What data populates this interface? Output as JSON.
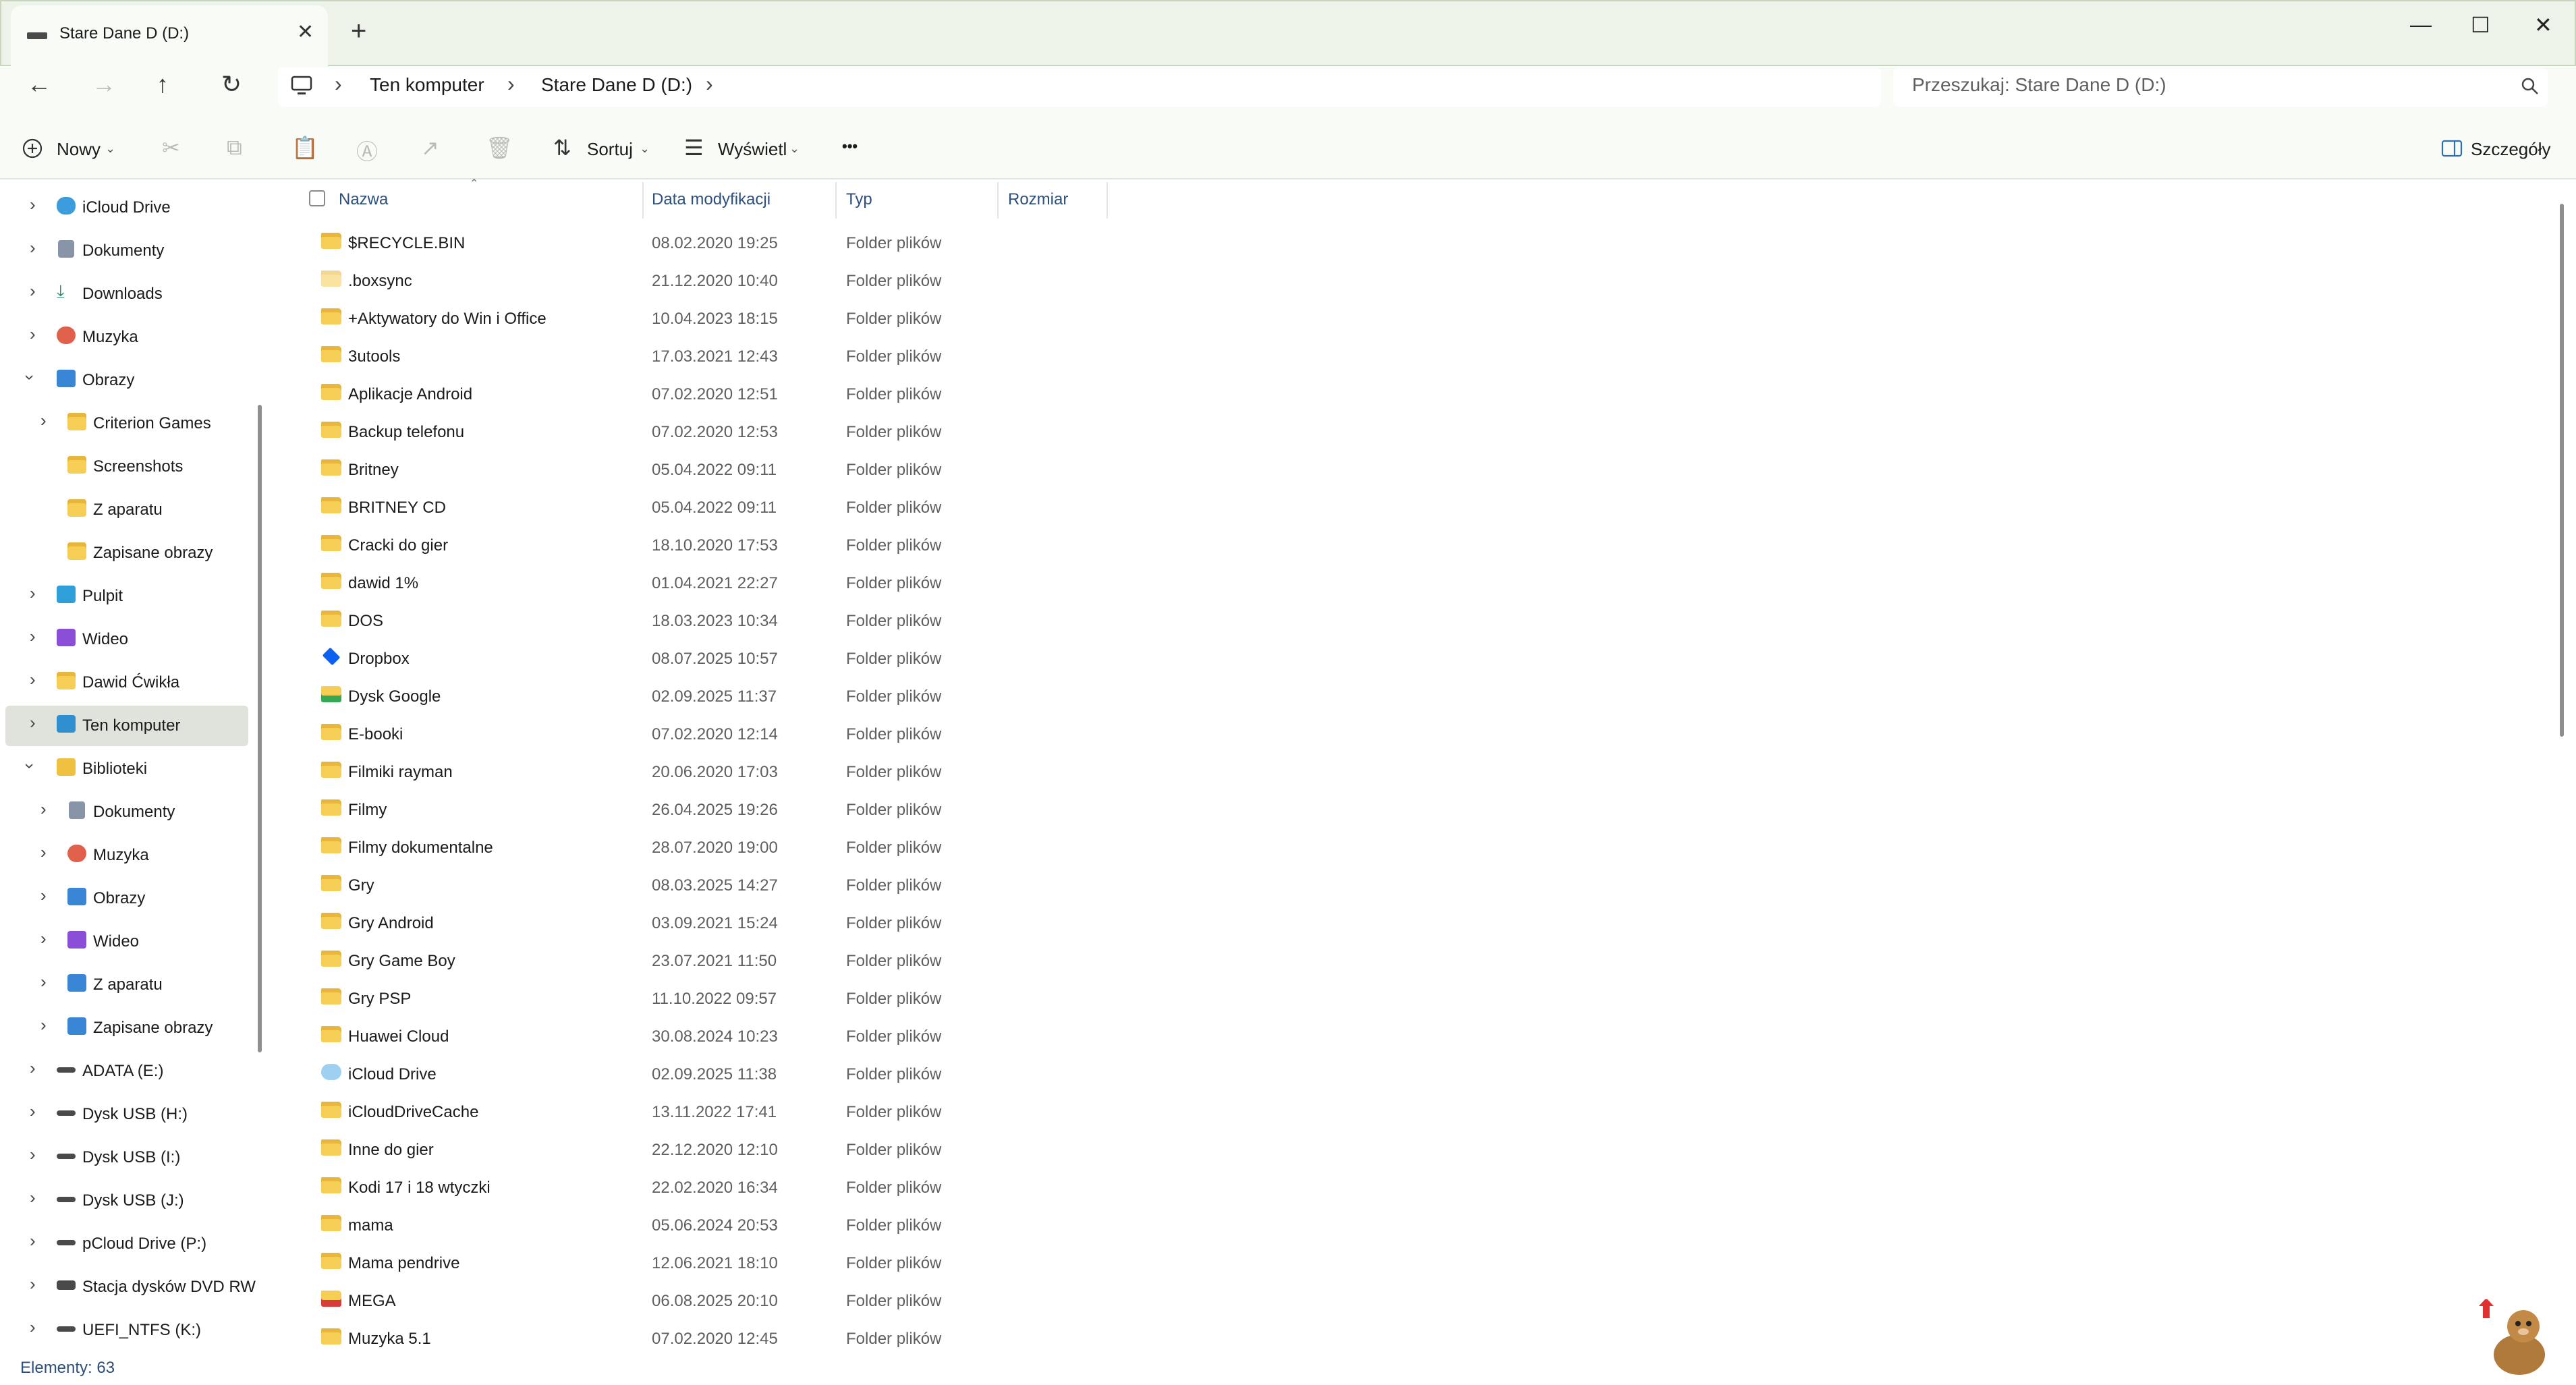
{
  "window": {
    "tab_title": "Stare Dane D (D:)",
    "tab_close": "✕",
    "new_tab": "+",
    "minimize": "—",
    "maximize": "☐",
    "close": "✕"
  },
  "nav": {
    "back": "←",
    "forward": "→",
    "up": "↑",
    "refresh": "↻",
    "breadcrumbs": [
      "Ten komputer",
      "Stare Dane D (D:)"
    ],
    "separator": "›"
  },
  "search": {
    "placeholder": "Przeszukaj: Stare Dane D (D:)"
  },
  "toolbar": {
    "new_label": "Nowy",
    "sort_label": "Sortuj",
    "view_label": "Wyświetl",
    "more": "•••",
    "details_label": "Szczegóły"
  },
  "sidebar": {
    "items": [
      {
        "label": "iCloud Drive",
        "icon": "icloud-icon",
        "color": "#3b9ddd"
      },
      {
        "label": "Dokumenty",
        "icon": "documents-icon",
        "color": "#8894a8"
      },
      {
        "label": "Downloads",
        "icon": "download-icon",
        "color": "#2f8a6a"
      },
      {
        "label": "Muzyka",
        "icon": "music-icon",
        "color": "#e0604c"
      },
      {
        "label": "Obrazy",
        "icon": "pictures-icon",
        "color": "#3a86d6"
      },
      {
        "label": "Criterion Games",
        "icon": "folder-icon",
        "color": "#f6cd55"
      },
      {
        "label": "Screenshots",
        "icon": "folder-icon",
        "color": "#f6cd55"
      },
      {
        "label": "Z aparatu",
        "icon": "folder-icon",
        "color": "#f6cd55"
      },
      {
        "label": "Zapisane obrazy",
        "icon": "folder-icon",
        "color": "#f6cd55"
      },
      {
        "label": "Pulpit",
        "icon": "desktop-icon",
        "color": "#2f9fd9"
      },
      {
        "label": "Wideo",
        "icon": "video-icon",
        "color": "#8a4fd6"
      },
      {
        "label": "Dawid Ćwikła",
        "icon": "folder-icon",
        "color": "#f6cd55"
      },
      {
        "label": "Ten komputer",
        "icon": "computer-icon",
        "color": "#2f8fcf"
      },
      {
        "label": "Biblioteki",
        "icon": "libraries-icon",
        "color": "#f0c040"
      },
      {
        "label": "Dokumenty",
        "icon": "documents-icon",
        "color": "#8894a8"
      },
      {
        "label": "Muzyka",
        "icon": "music-icon",
        "color": "#e0604c"
      },
      {
        "label": "Obrazy",
        "icon": "pictures-icon",
        "color": "#3a86d6"
      },
      {
        "label": "Wideo",
        "icon": "video-icon",
        "color": "#8a4fd6"
      },
      {
        "label": "Z aparatu",
        "icon": "pictures-icon",
        "color": "#3a86d6"
      },
      {
        "label": "Zapisane obrazy",
        "icon": "pictures-icon",
        "color": "#3a86d6"
      },
      {
        "label": "ADATA (E:)",
        "icon": "drive-icon",
        "color": "#4a4a4a"
      },
      {
        "label": "Dysk USB (H:)",
        "icon": "drive-icon",
        "color": "#4a4a4a"
      },
      {
        "label": "Dysk USB (I:)",
        "icon": "drive-icon",
        "color": "#4a4a4a"
      },
      {
        "label": "Dysk USB (J:)",
        "icon": "drive-icon",
        "color": "#4a4a4a"
      },
      {
        "label": "pCloud Drive (P:)",
        "icon": "drive-icon",
        "color": "#4a4a4a"
      },
      {
        "label": "Stacja dysków DVD RW",
        "icon": "dvd-drive-icon",
        "color": "#4a4a4a"
      },
      {
        "label": "UEFI_NTFS (K:)",
        "icon": "drive-icon",
        "color": "#4a4a4a"
      }
    ]
  },
  "columns": {
    "name": "Nazwa",
    "date": "Data modyfikacji",
    "type": "Typ",
    "size": "Rozmiar"
  },
  "files": [
    {
      "name": "$RECYCLE.BIN",
      "date": "08.02.2020 19:25",
      "type": "Folder plików",
      "icon": "folder-icon"
    },
    {
      "name": ".boxsync",
      "date": "21.12.2020 10:40",
      "type": "Folder plików",
      "icon": "folder-icon"
    },
    {
      "name": "+Aktywatory do Win i Office",
      "date": "10.04.2023 18:15",
      "type": "Folder plików",
      "icon": "folder-icon"
    },
    {
      "name": "3utools",
      "date": "17.03.2021 12:43",
      "type": "Folder plików",
      "icon": "folder-icon"
    },
    {
      "name": "Aplikacje Android",
      "date": "07.02.2020 12:51",
      "type": "Folder plików",
      "icon": "folder-icon"
    },
    {
      "name": "Backup telefonu",
      "date": "07.02.2020 12:53",
      "type": "Folder plików",
      "icon": "folder-icon"
    },
    {
      "name": "Britney",
      "date": "05.04.2022 09:11",
      "type": "Folder plików",
      "icon": "folder-icon"
    },
    {
      "name": "BRITNEY CD",
      "date": "05.04.2022 09:11",
      "type": "Folder plików",
      "icon": "folder-icon"
    },
    {
      "name": "Cracki do gier",
      "date": "18.10.2020 17:53",
      "type": "Folder plików",
      "icon": "folder-icon"
    },
    {
      "name": "dawid 1%",
      "date": "01.04.2021 22:27",
      "type": "Folder plików",
      "icon": "folder-icon"
    },
    {
      "name": "DOS",
      "date": "18.03.2023 10:34",
      "type": "Folder plików",
      "icon": "folder-icon"
    },
    {
      "name": "Dropbox",
      "date": "08.07.2025 10:57",
      "type": "Folder plików",
      "icon": "dropbox-icon"
    },
    {
      "name": "Dysk Google",
      "date": "02.09.2025 11:37",
      "type": "Folder plików",
      "icon": "google-drive-folder-icon"
    },
    {
      "name": "E-booki",
      "date": "07.02.2020 12:14",
      "type": "Folder plików",
      "icon": "folder-icon"
    },
    {
      "name": "Filmiki rayman",
      "date": "20.06.2020 17:03",
      "type": "Folder plików",
      "icon": "folder-icon"
    },
    {
      "name": "Filmy",
      "date": "26.04.2025 19:26",
      "type": "Folder plików",
      "icon": "folder-icon"
    },
    {
      "name": "Filmy dokumentalne",
      "date": "28.07.2020 19:00",
      "type": "Folder plików",
      "icon": "folder-icon"
    },
    {
      "name": "Gry",
      "date": "08.03.2025 14:27",
      "type": "Folder plików",
      "icon": "folder-icon"
    },
    {
      "name": "Gry Android",
      "date": "03.09.2021 15:24",
      "type": "Folder plików",
      "icon": "folder-icon"
    },
    {
      "name": "Gry Game Boy",
      "date": "23.07.2021 11:50",
      "type": "Folder plików",
      "icon": "folder-icon"
    },
    {
      "name": "Gry PSP",
      "date": "11.10.2022 09:57",
      "type": "Folder plików",
      "icon": "folder-icon"
    },
    {
      "name": "Huawei Cloud",
      "date": "30.08.2024 10:23",
      "type": "Folder plików",
      "icon": "folder-icon"
    },
    {
      "name": "iCloud Drive",
      "date": "02.09.2025 11:38",
      "type": "Folder plików",
      "icon": "icloud-folder-icon"
    },
    {
      "name": "iCloudDriveCache",
      "date": "13.11.2022 17:41",
      "type": "Folder plików",
      "icon": "folder-icon"
    },
    {
      "name": "Inne do gier",
      "date": "22.12.2020 12:10",
      "type": "Folder plików",
      "icon": "folder-icon"
    },
    {
      "name": "Kodi 17 i 18 wtyczki",
      "date": "22.02.2020 16:34",
      "type": "Folder plików",
      "icon": "folder-icon"
    },
    {
      "name": "mama",
      "date": "05.06.2024 20:53",
      "type": "Folder plików",
      "icon": "folder-icon"
    },
    {
      "name": "Mama pendrive",
      "date": "12.06.2021 18:10",
      "type": "Folder plików",
      "icon": "folder-icon"
    },
    {
      "name": "MEGA",
      "date": "06.08.2025 20:10",
      "type": "Folder plików",
      "icon": "mega-folder-icon"
    },
    {
      "name": "Muzyka 5.1",
      "date": "07.02.2020 12:45",
      "type": "Folder plików",
      "icon": "folder-icon"
    }
  ],
  "status": {
    "items_count": "Elementy: 63"
  }
}
